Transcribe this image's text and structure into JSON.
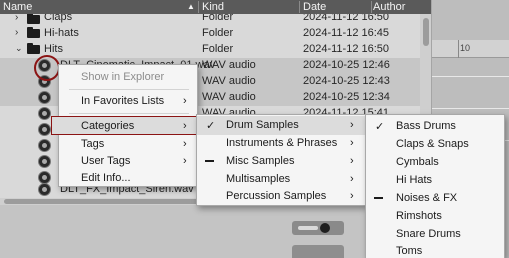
{
  "header": {
    "name": "Name",
    "kind": "Kind",
    "date": "Date",
    "author": "Author"
  },
  "rows": [
    {
      "name": "Claps",
      "kind": "Folder",
      "date": "2024-11-12 16:50"
    },
    {
      "name": "Hi-hats",
      "kind": "Folder",
      "date": "2024-11-12 16:45"
    },
    {
      "name": "Hits",
      "kind": "Folder",
      "date": "2024-11-12 16:50"
    },
    {
      "name": "DLT_Cinematic_Impact_01.wav",
      "kind": "WAV audio",
      "date": "2024-10-25 12:46"
    },
    {
      "name": "",
      "kind": "WAV audio",
      "date": "2024-10-25 12:43"
    },
    {
      "name": "",
      "kind": "WAV audio",
      "date": "2024-10-25 12:34"
    },
    {
      "name": "",
      "kind": "WAV audio",
      "date": "2024-11-12 15:41"
    },
    {
      "name": "DLT_FX_Impact_Siren.wav",
      "kind": "",
      "date": ""
    }
  ],
  "ruler": {
    "marker": "10"
  },
  "menu1": {
    "items": [
      {
        "label": "Show in Explorer",
        "disabled": true
      },
      {
        "label": "In Favorites Lists",
        "submenu": true
      },
      {
        "label": "Categories",
        "submenu": true
      },
      {
        "label": "Tags",
        "submenu": true
      },
      {
        "label": "User Tags",
        "submenu": true
      },
      {
        "label": "Edit Info..."
      }
    ]
  },
  "menu2": {
    "items": [
      {
        "label": "Drum Samples",
        "state": "check"
      },
      {
        "label": "Instruments & Phrases",
        "state": ""
      },
      {
        "label": "Misc Samples",
        "state": "dash"
      },
      {
        "label": "Multisamples",
        "state": ""
      },
      {
        "label": "Percussion Samples",
        "state": ""
      }
    ]
  },
  "menu3": {
    "items": [
      {
        "label": "Bass Drums",
        "state": "check"
      },
      {
        "label": "Claps & Snaps",
        "state": ""
      },
      {
        "label": "Cymbals",
        "state": ""
      },
      {
        "label": "Hi Hats",
        "state": ""
      },
      {
        "label": "Noises & FX",
        "state": "dash"
      },
      {
        "label": "Rimshots",
        "state": ""
      },
      {
        "label": "Snare Drums",
        "state": ""
      },
      {
        "label": "Toms",
        "state": ""
      }
    ]
  },
  "glyphs": {
    "arrow": "›",
    "check": "✓",
    "sort": "▲"
  }
}
